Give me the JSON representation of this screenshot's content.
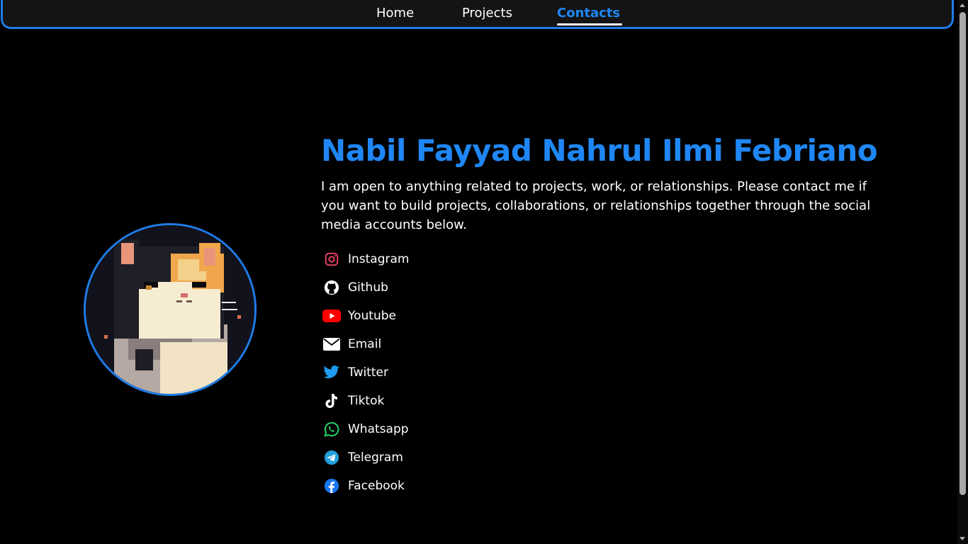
{
  "nav": {
    "home": "Home",
    "projects": "Projects",
    "contacts": "Contacts",
    "active": "Contacts",
    "accent_color": "#1f87f5"
  },
  "profile": {
    "name": "Nabil Fayyad Nahrul Ilmi Febriano",
    "intro": "I am open to anything related to projects, work, or relationships. Please contact me if you want to build projects, collaborations, or relationships together through the social media accounts below."
  },
  "contacts": [
    {
      "label": "Instagram",
      "icon": "instagram-icon"
    },
    {
      "label": "Github",
      "icon": "github-icon"
    },
    {
      "label": "Youtube",
      "icon": "youtube-icon"
    },
    {
      "label": "Email",
      "icon": "email-icon"
    },
    {
      "label": "Twitter",
      "icon": "twitter-icon"
    },
    {
      "label": "Tiktok",
      "icon": "tiktok-icon"
    },
    {
      "label": "Whatsapp",
      "icon": "whatsapp-icon"
    },
    {
      "label": "Telegram",
      "icon": "telegram-icon"
    },
    {
      "label": "Facebook",
      "icon": "facebook-icon"
    }
  ]
}
